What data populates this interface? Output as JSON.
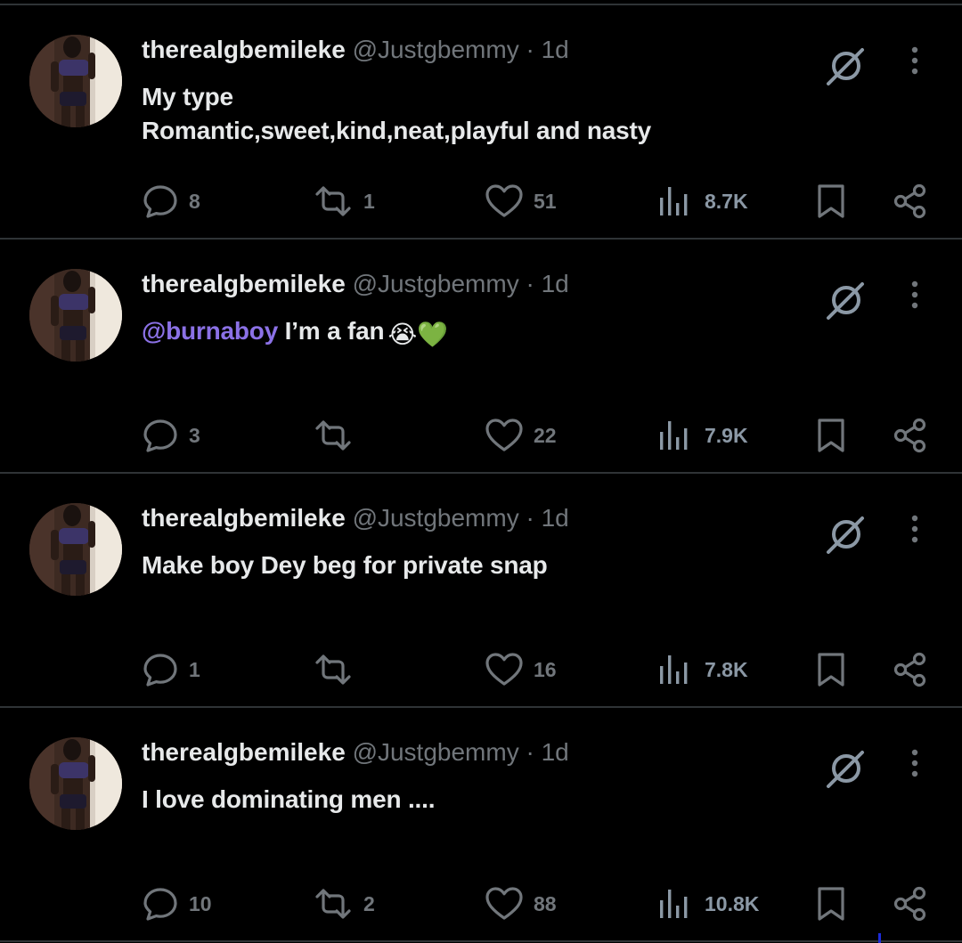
{
  "tweets": [
    {
      "name": "therealgbemileke",
      "handle": "@Justgbemmy",
      "separator": "·",
      "time": "1d",
      "text": "My type\nRomantic,sweet,kind,neat,playful and nasty",
      "mention": "",
      "emoji": "",
      "replies": "8",
      "retweets": "1",
      "likes": "51",
      "views": "8.7K"
    },
    {
      "name": "therealgbemileke",
      "handle": "@Justgbemmy",
      "separator": "·",
      "time": "1d",
      "text": " I’m a fan",
      "mention": "@burnaboy",
      "emoji": "😭💚",
      "replies": "3",
      "retweets": "",
      "likes": "22",
      "views": "7.9K"
    },
    {
      "name": "therealgbemileke",
      "handle": "@Justgbemmy",
      "separator": "·",
      "time": "1d",
      "text": "Make boy Dey beg for private snap",
      "mention": "",
      "emoji": "",
      "replies": "1",
      "retweets": "",
      "likes": "16",
      "views": "7.8K"
    },
    {
      "name": "therealgbemileke",
      "handle": "@Justgbemmy",
      "separator": "·",
      "time": "1d",
      "text": "I love dominating men ....",
      "mention": "",
      "emoji": "",
      "replies": "10",
      "retweets": "2",
      "likes": "88",
      "views": "10.8K"
    }
  ],
  "icons": {
    "grok": "grok-icon",
    "more": "more-vertical-icon",
    "reply": "reply-icon",
    "retweet": "retweet-icon",
    "like": "heart-icon",
    "views": "views-bar-chart-icon",
    "bookmark": "bookmark-icon",
    "share": "share-icon"
  },
  "colors": {
    "background": "#000000",
    "text": "#e7e9ea",
    "muted": "#71767b",
    "mention": "#8b71e6",
    "divider": "#2f3336"
  }
}
